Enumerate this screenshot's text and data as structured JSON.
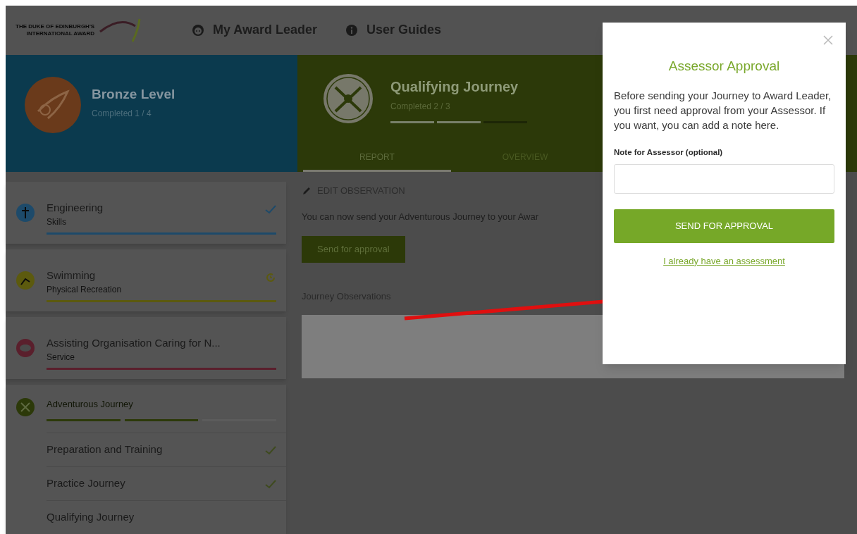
{
  "header": {
    "logo_lines": [
      "THE DUKE OF EDINBURGH'S",
      "INTERNATIONAL AWARD"
    ],
    "nav": [
      {
        "label": "My Award Leader",
        "kind": "face"
      },
      {
        "label": "User Guides",
        "kind": "info"
      }
    ]
  },
  "level_panel": {
    "title": "Bronze Level",
    "subtitle": "Completed 1 / 4"
  },
  "journey_panel": {
    "title": "Qualifying Journey",
    "subtitle": "Completed 2 / 3",
    "segments": [
      {
        "filled": true
      },
      {
        "filled": true
      },
      {
        "filled": false
      }
    ],
    "tabs": [
      {
        "label": "REPORT",
        "selected": true
      },
      {
        "label": "OVERVIEW",
        "selected": false
      }
    ]
  },
  "sidebar": {
    "activities": [
      {
        "title": "Engineering",
        "subtitle": "Skills",
        "checked": true,
        "in_progress": false,
        "color": "#1d4a6a"
      },
      {
        "title": "Swimming",
        "subtitle": "Physical Recreation",
        "checked": false,
        "in_progress": true,
        "color": "#5c5a0e"
      },
      {
        "title": "Assisting Organisation Caring for N...",
        "subtitle": "Service",
        "checked": false,
        "in_progress": false,
        "color": "#5a1f2c"
      }
    ],
    "journey": {
      "title": "Adventurous Journey",
      "segments": [
        {
          "filled": true
        },
        {
          "filled": true
        },
        {
          "filled": false
        }
      ],
      "steps": [
        {
          "label": "Preparation and Training",
          "checked": true
        },
        {
          "label": "Practice Journey",
          "checked": true
        },
        {
          "label": "Qualifying Journey",
          "checked": false
        }
      ]
    }
  },
  "main": {
    "edit_link": "EDIT OBSERVATION",
    "message": "You can now send your Adventurous Journey to your Awar",
    "send_button": "Send for approval",
    "observations_label": "Journey Observations"
  },
  "modal": {
    "title": "Assessor Approval",
    "body": "Before sending your Journey to Award Leader, you first need approval from your Assessor. If you want, you can add a note here.",
    "note_label": "Note for Assessor (optional)",
    "button": "SEND FOR APPROVAL",
    "link": "I already have an assessment"
  }
}
